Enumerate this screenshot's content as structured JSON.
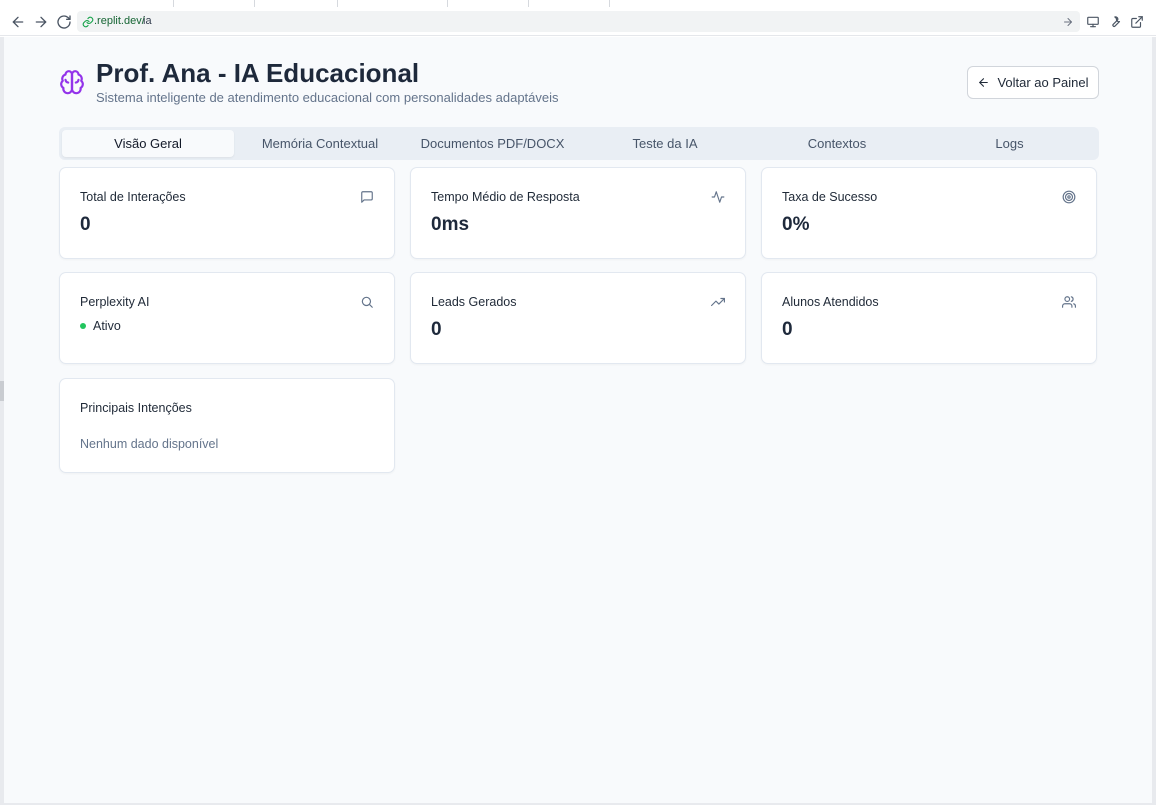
{
  "browser": {
    "url_domain": ".replit.dev/",
    "url_path": "ia"
  },
  "header": {
    "title": "Prof. Ana - IA Educacional",
    "subtitle": "Sistema inteligente de atendimento educacional com personalidades adaptáveis",
    "back_button": "Voltar ao Painel",
    "icon": "brain-icon"
  },
  "tabs": [
    {
      "label": "Visão Geral",
      "active": true
    },
    {
      "label": "Memória Contextual",
      "active": false
    },
    {
      "label": "Documentos PDF/DOCX",
      "active": false
    },
    {
      "label": "Teste da IA",
      "active": false
    },
    {
      "label": "Contextos",
      "active": false
    },
    {
      "label": "Logs",
      "active": false
    }
  ],
  "cards": {
    "total_interacoes": {
      "title": "Total de Interações",
      "value": "0",
      "icon": "message-icon"
    },
    "tempo_medio": {
      "title": "Tempo Médio de Resposta",
      "value": "0ms",
      "icon": "activity-icon"
    },
    "taxa_sucesso": {
      "title": "Taxa de Sucesso",
      "value": "0%",
      "icon": "target-icon"
    },
    "perplexity": {
      "title": "Perplexity AI",
      "status": "Ativo",
      "status_color": "#22c55e",
      "icon": "search-icon"
    },
    "leads": {
      "title": "Leads Gerados",
      "value": "0",
      "icon": "trending-up-icon"
    },
    "alunos": {
      "title": "Alunos Atendidos",
      "value": "0",
      "icon": "users-icon"
    },
    "intencoes": {
      "title": "Principais Intenções",
      "empty": "Nenhum dado disponível"
    }
  },
  "colors": {
    "accent": "#9333ea",
    "background": "#f8fafc"
  }
}
